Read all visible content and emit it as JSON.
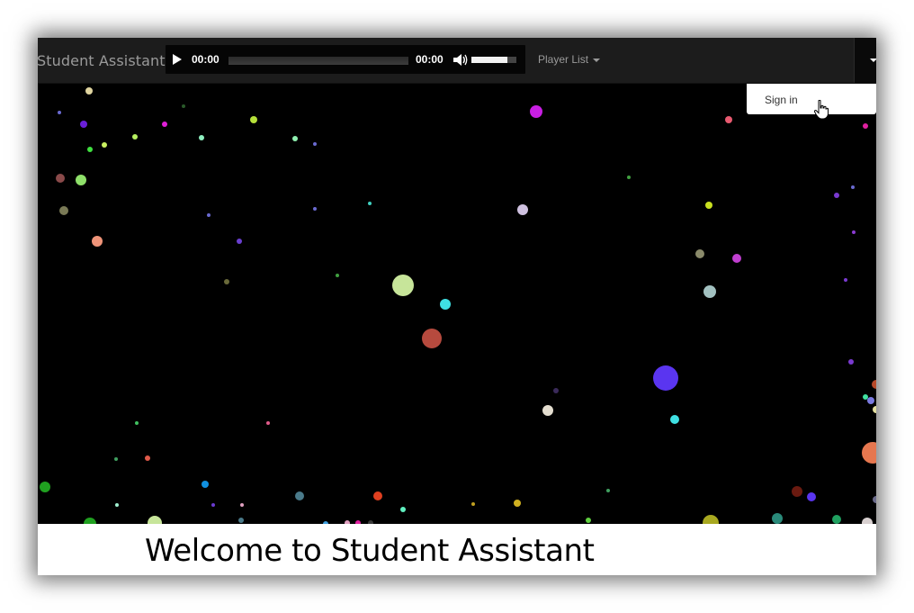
{
  "navbar": {
    "brand": "Student Assistant",
    "player_list_label": "Player List",
    "dropdown_item": "Sign in"
  },
  "player": {
    "current_time": "00:00",
    "duration": "00:00",
    "progress": 0,
    "volume": 0.8
  },
  "footer": {
    "welcome": "Welcome to Student Assistant"
  },
  "icons": {
    "play": "play-icon",
    "volume": "volume-icon",
    "caret": "caret-down-icon",
    "cursor": "hand-pointer-icon"
  },
  "colors": {
    "navbar_bg": "#1c1c1c",
    "stage_bg": "#000000",
    "dot_palette": [
      "#c7e59a",
      "#b64a3e",
      "#5a35f0",
      "#3fe0e3",
      "#c91fe3",
      "#e4ded0",
      "#ef9479",
      "#e6774f",
      "#cfc1e0",
      "#a2c1c0",
      "#7a7a56"
    ]
  }
}
